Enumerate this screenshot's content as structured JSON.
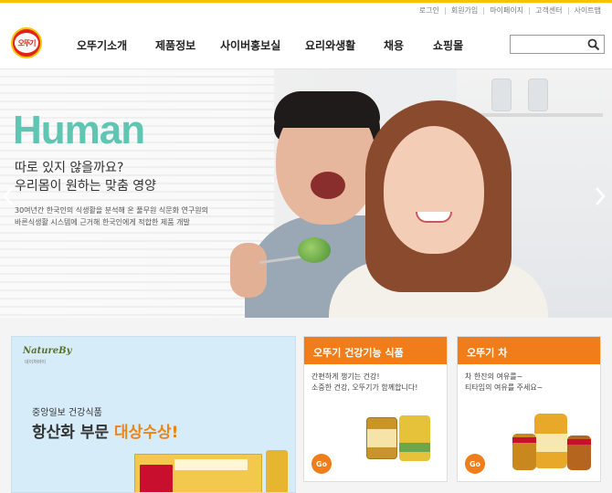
{
  "utility_links": [
    "로그인",
    "회원가입",
    "마이페이지",
    "고객센터",
    "사이트맵"
  ],
  "logo": {
    "text": "오뚜기"
  },
  "nav": [
    "오뚜기소개",
    "제품정보",
    "사이버홍보실",
    "요리와생활",
    "채용",
    "쇼핑몰"
  ],
  "search": {
    "placeholder": "",
    "icon": "search-icon"
  },
  "hero": {
    "title": "Human",
    "subtitle_line1": "따로 있지 않을까요?",
    "subtitle_line2": "우리몸이 원하는 맞춤 영양",
    "desc_line1": "30여년간 한국인의 식생활을 분석해 온 풀무원 식문화 연구원의",
    "desc_line2": "바른식생활 시스템에 근거해 한국인에게 적합한 제품 개발"
  },
  "promo": {
    "brand": "NatureBy",
    "brand_sub": "네이처바이",
    "line1": "중앙일보 건강식품",
    "line2_prefix": "항산화 부문 ",
    "line2_highlight": "대상수상!"
  },
  "cards": [
    {
      "title": "오뚜기 건강기능 식품",
      "text_line1": "간편하게 챙기는 건강!",
      "text_line2": "소중한 건강, 오뚜기가 함께합니다!",
      "go": "Go"
    },
    {
      "title": "오뚜기 차",
      "text_line1": "차 한잔의 여유를~",
      "text_line2": "티타임의 여유를 주세요~",
      "go": "Go"
    }
  ],
  "colors": {
    "accent_yellow": "#f4c400",
    "brand_red": "#e2231a",
    "hero_title": "#5ec6b2",
    "card_orange": "#f07d19"
  }
}
